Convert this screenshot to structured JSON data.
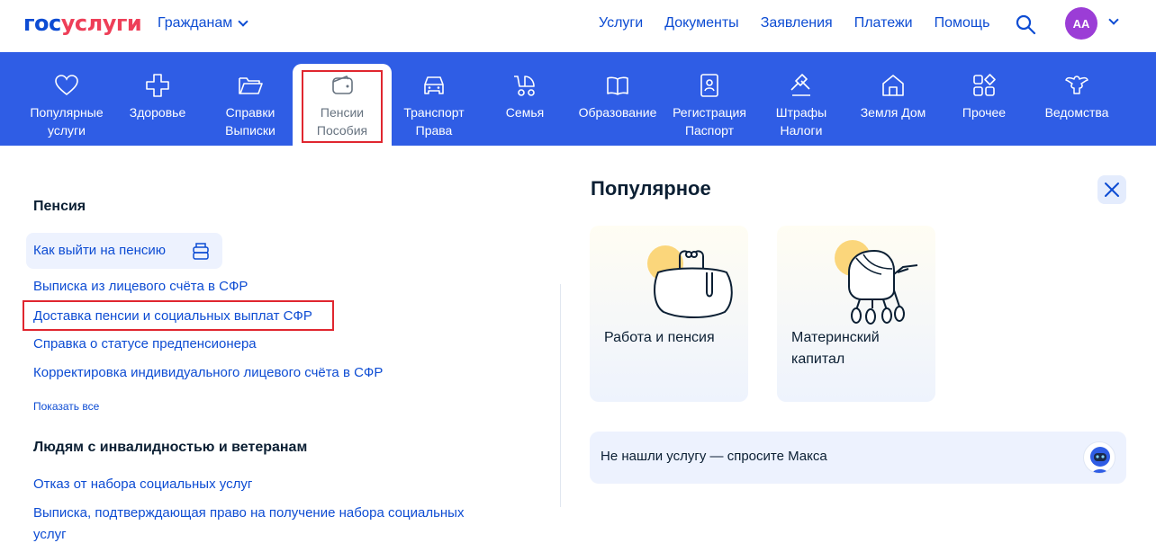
{
  "header": {
    "logo_part1": "гос",
    "logo_part2": "услуги",
    "audience_label": "Гражданам",
    "nav": [
      "Услуги",
      "Документы",
      "Заявления",
      "Платежи",
      "Помощь"
    ],
    "avatar_initials": "АА"
  },
  "categories": [
    {
      "l1": "Популярные",
      "l2": "услуги",
      "icon": "heart-icon"
    },
    {
      "l1": "Здоровье",
      "l2": "",
      "icon": "medical-cross-icon"
    },
    {
      "l1": "Справки",
      "l2": "Выписки",
      "icon": "folder-icon"
    },
    {
      "l1": "Пенсии",
      "l2": "Пособия",
      "icon": "wallet-icon",
      "active": true
    },
    {
      "l1": "Транспорт",
      "l2": "Права",
      "icon": "car-icon"
    },
    {
      "l1": "Семья",
      "l2": "",
      "icon": "stroller-icon"
    },
    {
      "l1": "Образование",
      "l2": "",
      "icon": "book-icon"
    },
    {
      "l1": "Регистрация",
      "l2": "Паспорт",
      "icon": "passport-icon"
    },
    {
      "l1": "Штрафы",
      "l2": "Налоги",
      "icon": "gavel-icon"
    },
    {
      "l1": "Земля Дом",
      "l2": "",
      "icon": "house-icon"
    },
    {
      "l1": "Прочее",
      "l2": "",
      "icon": "grid-icon"
    },
    {
      "l1": "Ведомства",
      "l2": "",
      "icon": "emblem-icon"
    }
  ],
  "pension": {
    "title": "Пенсия",
    "links": [
      "Как выйти на пенсию",
      "Выписка из лицевого счёта в СФР",
      "Доставка пенсии и социальных выплат СФР",
      "Справка о статусе предпенсионера",
      "Корректировка индивидуального лицевого счёта в СФР"
    ],
    "show_all": "Показать все"
  },
  "disabled": {
    "title": "Людям с инвалидностью и ветеранам",
    "links": [
      "Отказ от набора социальных услуг",
      "Выписка, подтверждающая право на получение набора социальных",
      "услуг"
    ]
  },
  "popular": {
    "title": "Популярное",
    "cards": [
      {
        "l1": "Работа и пенсия",
        "l2": ""
      },
      {
        "l1": "Материнский",
        "l2": "капитал"
      }
    ]
  },
  "ask": {
    "text": "Не нашли услугу — спросите Макса"
  },
  "colors": {
    "brand_blue": "#0d4cd3",
    "band_blue": "#2f5de5",
    "brand_red": "#ee3f58",
    "avatar_purple": "#9b3dd6",
    "highlight_red": "#e0262f"
  }
}
